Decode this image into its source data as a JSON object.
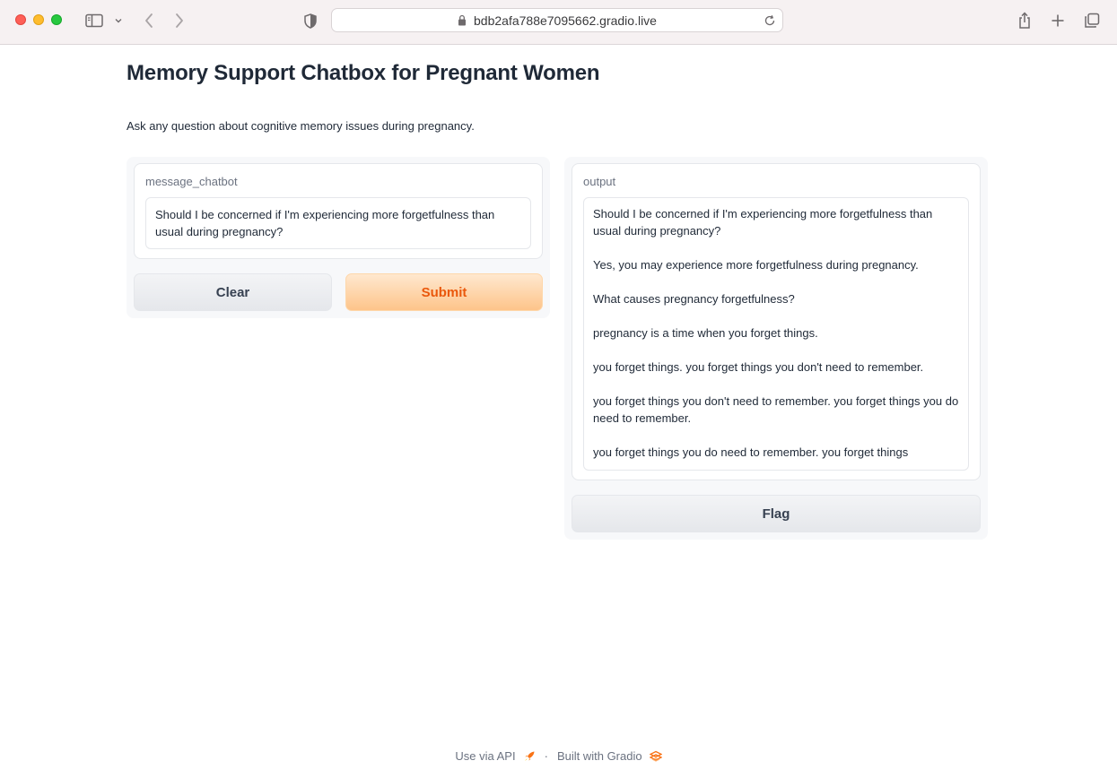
{
  "browser": {
    "url": "bdb2afa788e7095662.gradio.live"
  },
  "page": {
    "title": "Memory Support Chatbox for Pregnant Women",
    "description": "Ask any question about cognitive memory issues during pregnancy."
  },
  "input": {
    "label": "message_chatbot",
    "value": "Should I be concerned if I'm experiencing more forgetfulness than usual during pregnancy?"
  },
  "buttons": {
    "clear": "Clear",
    "submit": "Submit",
    "flag": "Flag"
  },
  "output": {
    "label": "output",
    "paragraphs": [
      "Should I be concerned if I'm experiencing more forgetfulness than usual during pregnancy?",
      "Yes, you may experience more forgetfulness during pregnancy.",
      "What causes pregnancy forgetfulness?",
      "pregnancy is a time when you forget things.",
      "you forget things. you forget things you don't need to remember.",
      "you forget things you don't need to remember. you forget things you do need to remember.",
      "you forget things you do need to remember. you forget things"
    ]
  },
  "footer": {
    "api_link": "Use via API",
    "separator": "·",
    "built_with": "Built with Gradio"
  },
  "colors": {
    "accent": "#ea580c",
    "submit_bg": "#fdc48a"
  }
}
